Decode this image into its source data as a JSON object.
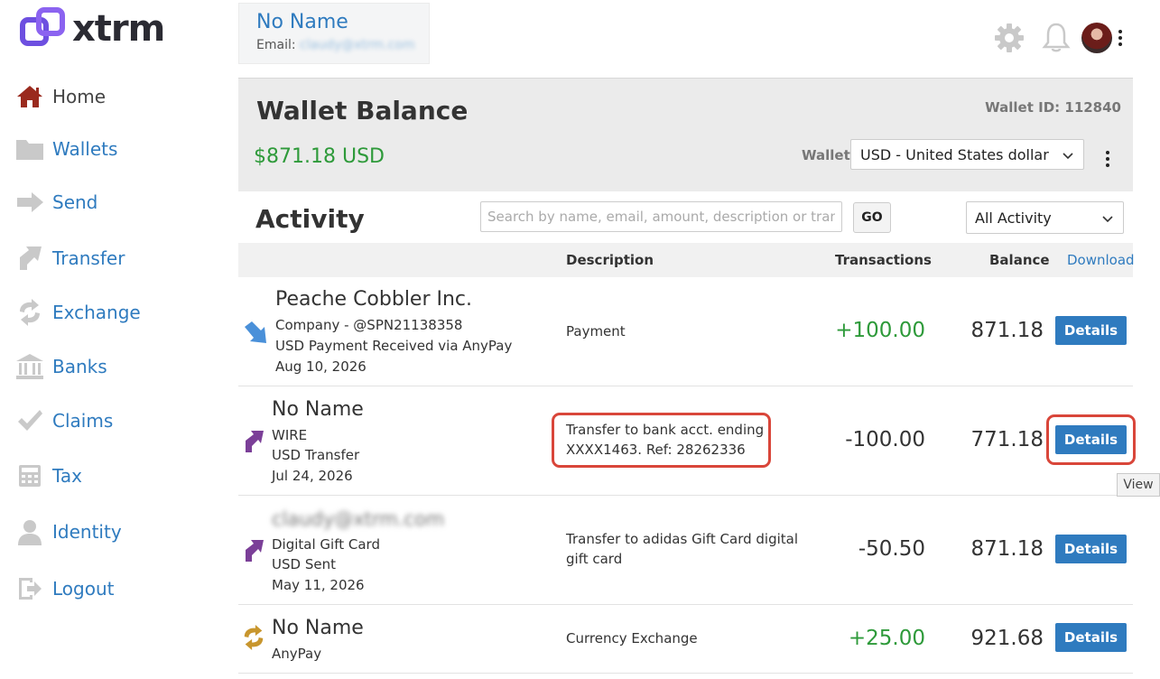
{
  "logo": {
    "text": "xtrm",
    "accent": "#6d4fe0"
  },
  "sidebar": {
    "items": [
      {
        "label": "Home",
        "icon": "home-icon"
      },
      {
        "label": "Wallets",
        "icon": "folder-icon"
      },
      {
        "label": "Send",
        "icon": "send-arrow-icon"
      },
      {
        "label": "Transfer",
        "icon": "transfer-arrow-icon"
      },
      {
        "label": "Exchange",
        "icon": "exchange-icon"
      },
      {
        "label": "Banks",
        "icon": "bank-icon"
      },
      {
        "label": "Claims",
        "icon": "checkmark-icon"
      },
      {
        "label": "Tax",
        "icon": "calculator-icon"
      },
      {
        "label": "Identity",
        "icon": "person-icon"
      },
      {
        "label": "Logout",
        "icon": "logout-icon"
      }
    ],
    "active": "Home"
  },
  "user": {
    "name": "No Name",
    "email_label": "Email:",
    "email": "claudy@xtrm.com"
  },
  "header": {
    "settings_icon": "gear-icon",
    "notification_icon": "bell-icon",
    "avatar": "avatar",
    "menu_icon": "kebab-icon"
  },
  "wallet": {
    "title": "Wallet Balance",
    "balance": "$871.18 USD",
    "id_label": "Wallet ID: 112840",
    "select_label": "Wallet:",
    "selected": "USD - United States dollar"
  },
  "activity": {
    "title": "Activity",
    "search_placeholder": "Search by name, email, amount, description or transaction",
    "go_label": "GO",
    "filter_selected": "All Activity"
  },
  "table": {
    "headers": {
      "description": "Description",
      "transactions": "Transactions",
      "balance": "Balance",
      "download": "Download"
    },
    "rows": [
      {
        "name": "Peache Cobbler Inc.",
        "line1": "Company - @SPN21138358",
        "line2": "USD Payment Received via AnyPay",
        "date": "Aug 10, 2026",
        "description": "Payment",
        "amount": "+100.00",
        "balance": "871.18",
        "button": "Details",
        "icon": "received-arrow-icon"
      },
      {
        "name": "No Name",
        "line1": "WIRE",
        "line2": "USD Transfer",
        "date": "Jul 24, 2026",
        "description": "Transfer to bank acct. ending XXXX1463. Ref: 28262336",
        "amount": "-100.00",
        "balance": "771.18",
        "button": "Details",
        "icon": "transfer-out-arrow-icon"
      },
      {
        "name": "claudy@xtrm.com",
        "line1": "Digital Gift Card",
        "line2": "USD Sent",
        "date": "May 11, 2026",
        "description": "Transfer to adidas Gift Card digital gift card",
        "amount": "-50.50",
        "balance": "871.18",
        "button": "Details",
        "icon": "transfer-out-arrow-icon"
      },
      {
        "name": "No Name",
        "line1": "AnyPay",
        "description": "Currency Exchange",
        "amount": "+25.00",
        "balance": "921.68",
        "button": "Details",
        "icon": "exchange-icon"
      }
    ]
  },
  "tooltip": {
    "text": "View"
  },
  "colors": {
    "link": "#2f7bbf",
    "positive": "#2e9a3a",
    "button": "#2f7bbf",
    "highlight": "#d9463a",
    "transfer_icon": "#7b3f98",
    "exchange_icon": "#c8962e",
    "received_icon": "#4a90d9"
  }
}
